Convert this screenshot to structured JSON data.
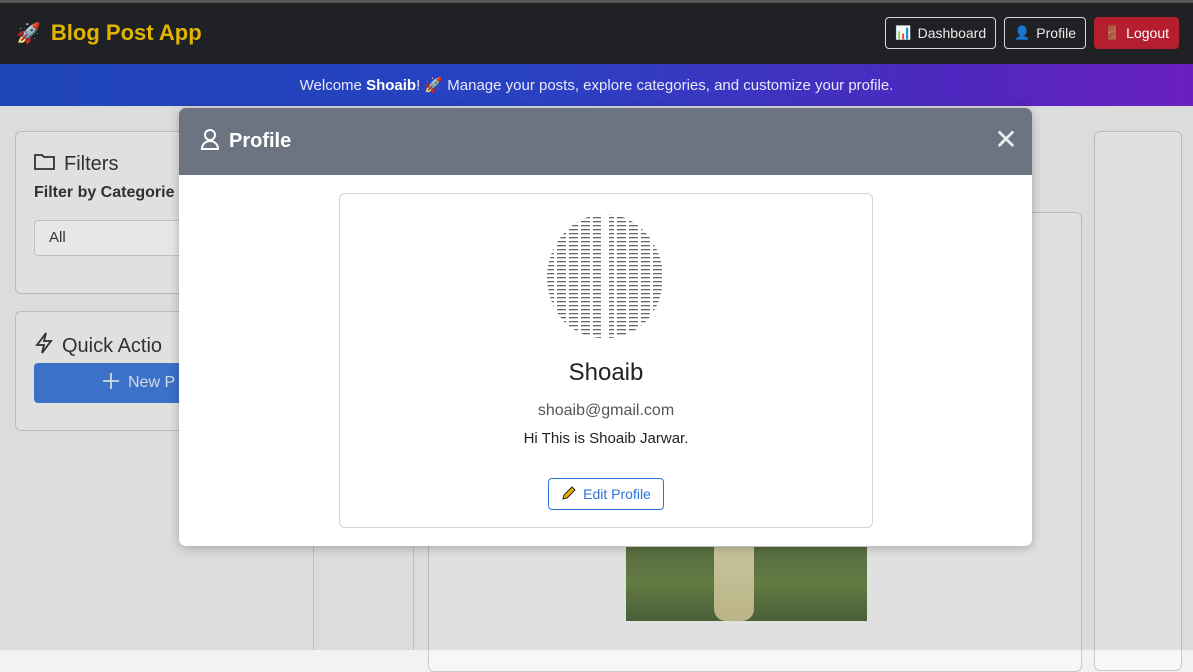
{
  "app": {
    "title": "Blog Post App",
    "brand_icon": "rocket-icon"
  },
  "nav": {
    "dashboard_label": "Dashboard",
    "profile_label": "Profile",
    "logout_label": "Logout"
  },
  "banner": {
    "prefix": "Welcome ",
    "user": "Shoaib",
    "suffix": "! 🚀 Manage your posts, explore categories, and customize your profile."
  },
  "sidebar": {
    "filters_title": "Filters",
    "filter_label": "Filter by Categorie",
    "category_select_value": "All",
    "quick_actions_title": "Quick Actio",
    "new_post_label": "New P"
  },
  "modal": {
    "title": "Profile",
    "close_glyph": "✕",
    "name": "Shoaib",
    "email": "shoaib@gmail.com",
    "bio": "Hi This is Shoaib Jarwar.",
    "edit_label": "Edit Profile"
  },
  "colors": {
    "brand": "#e0b400",
    "logout": "#b51e2e",
    "primary": "#2a73d6",
    "modal_header": "#6b7480"
  }
}
